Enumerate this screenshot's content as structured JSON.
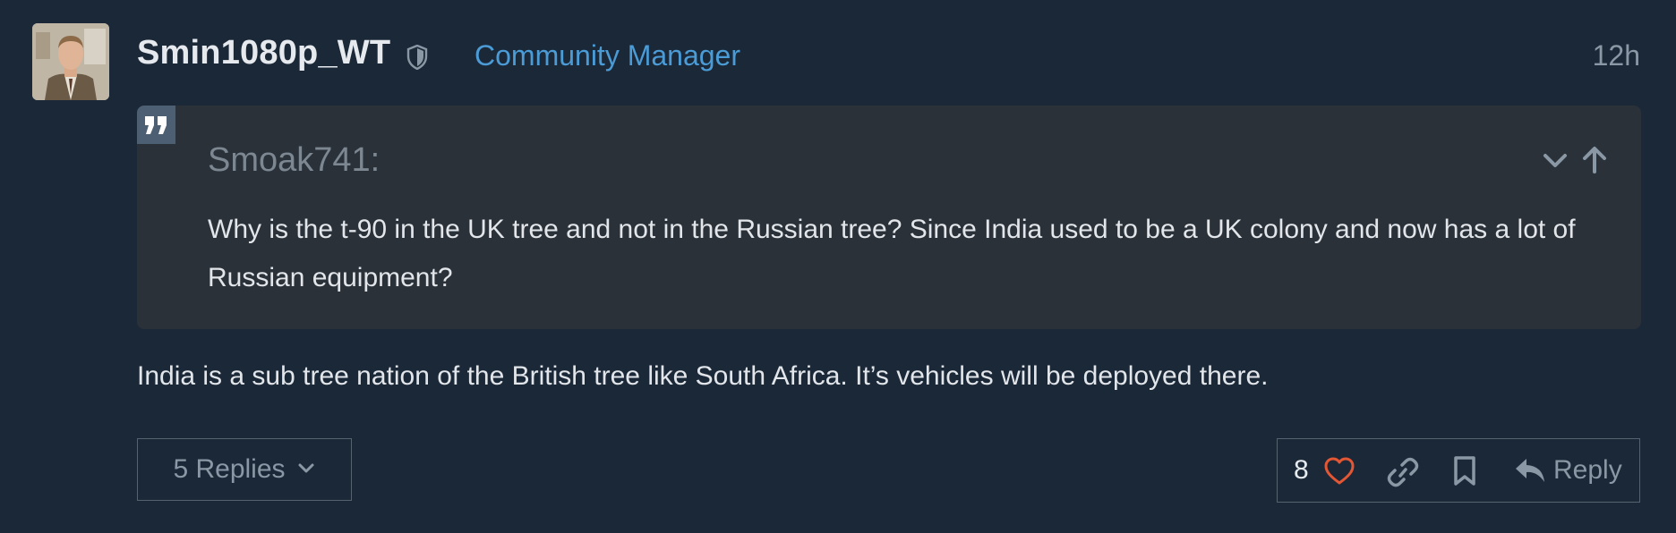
{
  "post": {
    "username": "Smin1080p_WT",
    "user_title": "Community Manager",
    "date": "12h",
    "quote": {
      "author": "Smoak741:",
      "text": "Why is the t-90 in the UK tree and not in the Russian tree? Since India used to be a UK colony and now has a lot of Russian equipment?"
    },
    "body": "India is a sub tree nation of the British tree like South Africa. It’s vehicles will be deployed there.",
    "replies_label": "5 Replies",
    "likes": "8",
    "reply_label": "Reply"
  },
  "colors": {
    "background": "#1b2838",
    "quote_background": "#2a3139",
    "accent_blue": "#4a9bd6",
    "like_red": "#e45735",
    "muted": "#8a97a4"
  },
  "icons": [
    "shield-icon",
    "quote-icon",
    "chevron-down-icon",
    "arrow-up-icon",
    "heart-icon",
    "link-icon",
    "bookmark-icon",
    "reply-icon"
  ]
}
